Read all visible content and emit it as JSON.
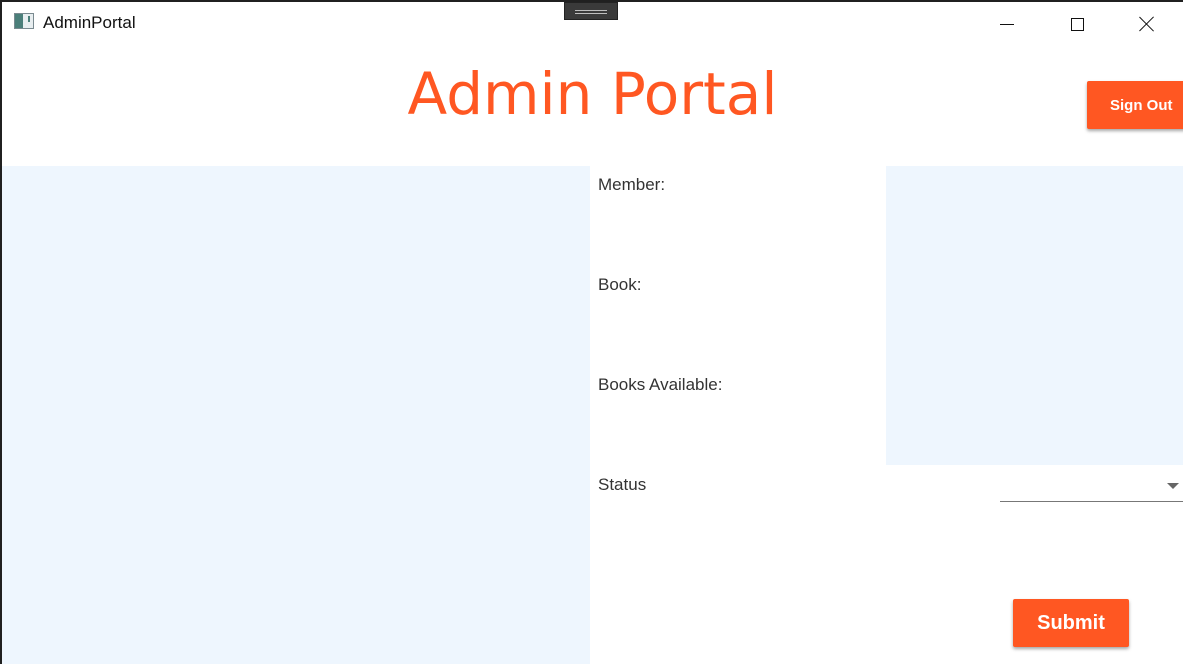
{
  "window": {
    "title": "AdminPortal",
    "icon": "app-window-icon",
    "controls": {
      "minimize": "minimize-icon",
      "maximize": "maximize-icon",
      "close": "close-icon"
    }
  },
  "header": {
    "title": "Admin Portal",
    "sign_out_label": "Sign Out"
  },
  "form": {
    "member_label": "Member:",
    "book_label": "Book:",
    "books_available_label": "Books Available:",
    "status_label": "Status",
    "status_value": "",
    "submit_label": "Submit"
  },
  "colors": {
    "accent": "#ff5722",
    "panel_background": "#eef6fe"
  }
}
